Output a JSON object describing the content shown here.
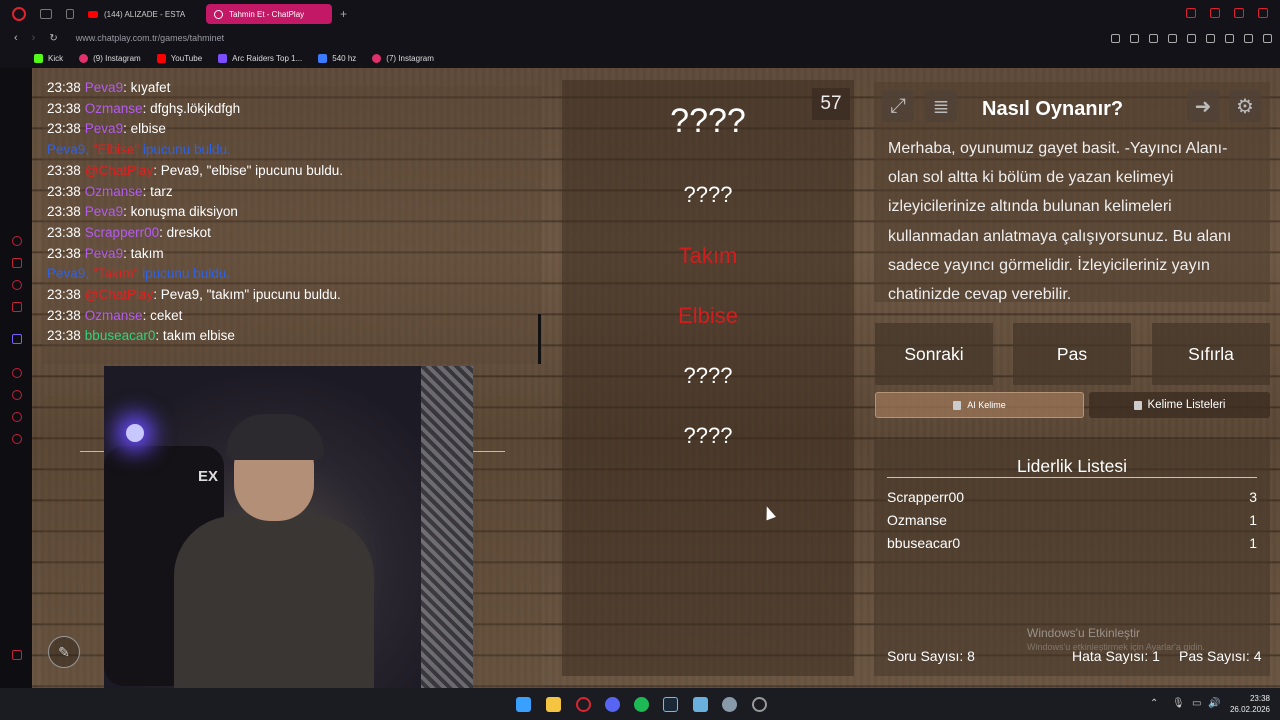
{
  "browser": {
    "tabs": [
      {
        "label": "(144) ALIZADE - ESTA"
      },
      {
        "label": "Tahmin Et - ChatPlay",
        "active": true
      }
    ],
    "new_tab": "+",
    "url": "www.chatplay.com.tr/games/tahminet",
    "bookmarks": [
      {
        "label": "Kick",
        "color": "#53fc18"
      },
      {
        "label": "(9) Instagram",
        "color": "#e1306c"
      },
      {
        "label": "YouTube",
        "color": "#ff0000"
      },
      {
        "label": "Arc Raiders Top 1...",
        "color": "#7b4dff"
      },
      {
        "label": "540 hz",
        "color": "#3a7bff"
      },
      {
        "label": "(7) Instagram",
        "color": "#e1306c"
      }
    ]
  },
  "chat": {
    "lines": [
      {
        "time": "23:38",
        "user": "Peva9",
        "sep": ": ",
        "msg": "kıyafet",
        "user_color": "purple"
      },
      {
        "time": "23:38",
        "user": "Ozmanse",
        "sep": ": ",
        "msg": "dfghş.lökjkdfgh",
        "user_color": "purple"
      },
      {
        "time": "23:38",
        "user": "Peva9",
        "sep": ": ",
        "msg": "elbise",
        "user_color": "purple"
      },
      {
        "system_user": "Peva9,",
        "system_word": "\"Elbise\"",
        "system_msg": "ipucunu buldu."
      },
      {
        "time": "23:38",
        "user": "@ChatPlay",
        "sep": ": ",
        "msg": "Peva9, \"elbise\" ipucunu buldu.",
        "user_color": "red"
      },
      {
        "time": "23:38",
        "user": "Ozmanse",
        "sep": ": ",
        "msg": "tarz",
        "user_color": "purple"
      },
      {
        "time": "23:38",
        "user": "Peva9",
        "sep": ": ",
        "msg": "konuşma diksiyon",
        "user_color": "purple"
      },
      {
        "time": "23:38",
        "user": "Scrapperr00",
        "sep": ": ",
        "msg": "dreskot",
        "user_color": "purple"
      },
      {
        "time": "23:38",
        "user": "Peva9",
        "sep": ": ",
        "msg": "takım",
        "user_color": "purple"
      },
      {
        "system_user": "Peva9,",
        "system_word": "\"Takım\"",
        "system_msg": "ipucunu buldu."
      },
      {
        "time": "23:38",
        "user": "@ChatPlay",
        "sep": ": ",
        "msg": "Peva9, \"takım\" ipucunu buldu.",
        "user_color": "red"
      },
      {
        "time": "23:38",
        "user": "Ozmanse",
        "sep": ": ",
        "msg": "ceket",
        "user_color": "purple"
      },
      {
        "time": "23:38",
        "user": "bbuseacar0",
        "sep": ": ",
        "msg": "takım elbise",
        "user_color": "green"
      }
    ]
  },
  "webcam": {
    "shirt_text": "EX"
  },
  "game": {
    "timer": "57",
    "main_word": "????",
    "clues": [
      "????",
      "Takım",
      "Elbise",
      "????",
      "????"
    ],
    "clue_found": [
      false,
      true,
      true,
      false,
      false
    ]
  },
  "info": {
    "title": "Nasıl Oynanır?",
    "text": "Merhaba, oyunumuz gayet basit. -Yayıncı Alanı- olan sol altta ki bölüm de yazan kelimeyi izleyicilerinize altında bulunan kelimeleri kullanmadan anlatmaya çalışıyorsunuz. Bu alanı sadece yayıncı görmelidir. İzleyicileriniz yayın chatinizde cevap verebilir."
  },
  "controls": {
    "next": "Sonraki",
    "pass": "Pas",
    "reset": "Sıfırla",
    "ai_word": "AI Kelime",
    "word_lists": "Kelime Listeleri"
  },
  "leaderboard": {
    "title": "Liderlik Listesi",
    "rows": [
      {
        "name": "Scrapperr00",
        "score": "3"
      },
      {
        "name": "Ozmanse",
        "score": "1"
      },
      {
        "name": "bbuseacar0",
        "score": "1"
      }
    ]
  },
  "stats": {
    "questions": "Soru Sayısı: 8",
    "errors": "Hata Sayısı: 1",
    "passes": "Pas Sayısı: 4"
  },
  "watermark": {
    "line1": "Windows'u Etkinleştir",
    "line2": "Windows'u etkinleştirmek için Ayarlar'a gidin."
  },
  "clock": {
    "time": "23:38",
    "date": "26.02.2026"
  },
  "colors": {
    "accent_tab": "#c21866",
    "found_clue": "#d21e1e",
    "chat_purple": "#b45cf0",
    "chat_blue": "#2a63f0",
    "chat_green": "#2fd37a"
  }
}
